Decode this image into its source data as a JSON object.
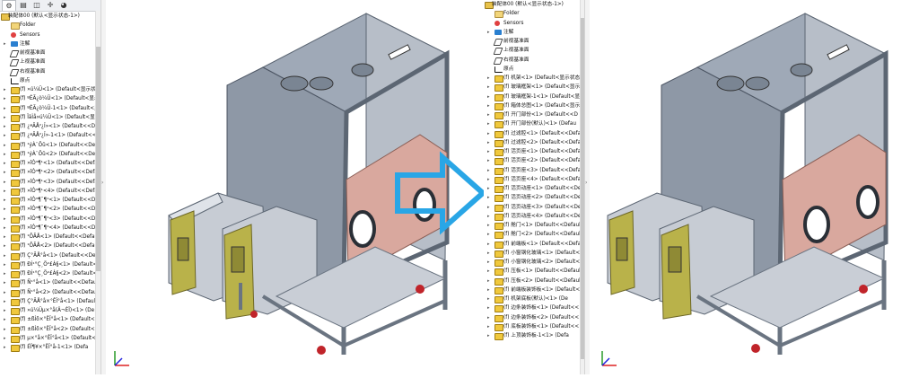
{
  "left_panel": {
    "tabs": [
      "feature-manager",
      "property-manager",
      "configuration-manager",
      "dimxpert-manager",
      "display-manager"
    ],
    "root": "装配体00 (默认<显示状态-1>)",
    "items": [
      {
        "label": "Folder",
        "icon": "folder-icon",
        "kind": "folder"
      },
      {
        "label": "Sensors",
        "icon": "sensor-icon",
        "kind": "sensor"
      },
      {
        "label": "注解",
        "icon": "annotation-icon",
        "kind": "anno",
        "arrow": true
      },
      {
        "label": "前视基准面",
        "icon": "plane-icon",
        "kind": "plane"
      },
      {
        "label": "上视基准面",
        "icon": "plane-icon",
        "kind": "plane"
      },
      {
        "label": "右视基准面",
        "icon": "plane-icon",
        "kind": "plane"
      },
      {
        "label": "原点",
        "icon": "origin-icon",
        "kind": "origin"
      },
      {
        "label": "(f) »ú¼Ü<1> (Default<显示状",
        "kind": "part"
      },
      {
        "label": "(f) ºÉÃ¿ò¼Ü<1> (Default<显示",
        "kind": "part"
      },
      {
        "label": "(f) ºÉÃ¿ò¼Ü-1<1> (Default<显示",
        "kind": "part"
      },
      {
        "label": "(f) ÏäÌå»ú¼Ü<1> (Default<显示",
        "kind": "part"
      },
      {
        "label": "(f) ¿ªÃÅ²¿Î»<1> (Default<<D",
        "kind": "part"
      },
      {
        "label": "(f) ¿ªÃÅ²¿Î»-1<1> (Default<<D",
        "kind": "part"
      },
      {
        "label": "(f) ¹ýÀ¨Õû<1> (Default<<Defau",
        "kind": "part"
      },
      {
        "label": "(f) ¹ýÀ¨Õû<2> (Default<<Defau",
        "kind": "part"
      },
      {
        "label": "(f) »îÒ³¶¹<1> (Default<<Defau",
        "kind": "part"
      },
      {
        "label": "(f) »îÒ³¶¹<2> (Default<<Defau",
        "kind": "part"
      },
      {
        "label": "(f) »îÒ³¶¹<3> (Default<<Defau",
        "kind": "part"
      },
      {
        "label": "(f) »îÒ³¶¹<4> (Default<<Defau",
        "kind": "part"
      },
      {
        "label": "(f) »îÒ³¶¯¶¹<1> (Default<<De",
        "kind": "part"
      },
      {
        "label": "(f) »îÒ³¶¯¶¹<2> (Default<<De",
        "kind": "part"
      },
      {
        "label": "(f) »îÒ³¶¯¶¹<3> (Default<<De",
        "kind": "part"
      },
      {
        "label": "(f) »îÒ³¶¯¶¹<4> (Default<<De",
        "kind": "part"
      },
      {
        "label": "(f) ¹ÔÃÅ<1> (Default<<Default",
        "kind": "part"
      },
      {
        "label": "(f) ¹ÔÃÅ<2> (Default<<Default",
        "kind": "part"
      },
      {
        "label": "(f) Ç°ÃÅ°å<1> (Default<<Defa",
        "kind": "part"
      },
      {
        "label": "(f) ÐÍ¹°Ç¸Ö²£Á§<1> (Default<",
        "kind": "part"
      },
      {
        "label": "(f) ÐÍ¹°Ç¸Ö²£Á§<2> (Default<",
        "kind": "part"
      },
      {
        "label": "(f) Ñ¹°å<1> (Default<<Default",
        "kind": "part"
      },
      {
        "label": "(f) Ñ¹°å<2> (Default<<Default",
        "kind": "part"
      },
      {
        "label": "(f) Ç°ÃÅ°å×°ÊÎ°å<1> (Default<",
        "kind": "part"
      },
      {
        "label": "(f) »ú¼Üµ×°å(Ä¬ÈÏ)<1> (De",
        "kind": "part"
      },
      {
        "label": "(f) ±ßÌõ×°ÊÎ°å<1> (Default<<",
        "kind": "part"
      },
      {
        "label": "(f) ±ßÌõ×°ÊÎ°å<2> (Default<<",
        "kind": "part"
      },
      {
        "label": "(f) µ×°å×°ÊÎ°å<1> (Default<<",
        "kind": "part"
      },
      {
        "label": "(f) ÉÏ¶¥×°ÊÎ°å-1<1> (Defa",
        "kind": "part"
      }
    ]
  },
  "right_panel": {
    "root": "装配体00 (默认<显示状态-1>)",
    "items": [
      {
        "label": "Folder",
        "icon": "folder-icon",
        "kind": "folder"
      },
      {
        "label": "Sensors",
        "icon": "sensor-icon",
        "kind": "sensor"
      },
      {
        "label": "注解",
        "icon": "annotation-icon",
        "kind": "anno",
        "arrow": true
      },
      {
        "label": "前视基准面",
        "icon": "plane-icon",
        "kind": "plane"
      },
      {
        "label": "上视基准面",
        "icon": "plane-icon",
        "kind": "plane"
      },
      {
        "label": "右视基准面",
        "icon": "plane-icon",
        "kind": "plane"
      },
      {
        "label": "原点",
        "icon": "origin-icon",
        "kind": "origin"
      },
      {
        "label": "(f) 机架<1> (Default<显示状态",
        "kind": "part"
      },
      {
        "label": "(f) 玻璃框架<1> (Default<显示",
        "kind": "part"
      },
      {
        "label": "(f) 玻璃框架-1<1> (Default<显",
        "kind": "part"
      },
      {
        "label": "(f) 箱体总图<1> (Default<显示",
        "kind": "part"
      },
      {
        "label": "(f) 开门部份<1> (Default<<D",
        "kind": "part"
      },
      {
        "label": "(f) 开门部份(默认)<1> (Defau",
        "kind": "part"
      },
      {
        "label": "(f) 过滤腔<1> (Default<<Defau",
        "kind": "part"
      },
      {
        "label": "(f) 过滤腔<2> (Default<<Defau",
        "kind": "part"
      },
      {
        "label": "(f) 活页座<1> (Default<<Defau",
        "kind": "part"
      },
      {
        "label": "(f) 活页座<2> (Default<<Defau",
        "kind": "part"
      },
      {
        "label": "(f) 活页座<3> (Default<<Defau",
        "kind": "part"
      },
      {
        "label": "(f) 活页座<4> (Default<<Defau",
        "kind": "part"
      },
      {
        "label": "(f) 活页动座<1> (Default<<De",
        "kind": "part"
      },
      {
        "label": "(f) 活页动座<2> (Default<<De",
        "kind": "part"
      },
      {
        "label": "(f) 活页动座<3> (Default<<De",
        "kind": "part"
      },
      {
        "label": "(f) 活页动座<4> (Default<<De",
        "kind": "part"
      },
      {
        "label": "(f) 舱门<1> (Default<<Default",
        "kind": "part"
      },
      {
        "label": "(f) 舱门<2> (Default<<Default",
        "kind": "part"
      },
      {
        "label": "(f) 前端板<1> (Default<<Defa",
        "kind": "part"
      },
      {
        "label": "(f) 小窗钢化玻璃<1> (Default<",
        "kind": "part"
      },
      {
        "label": "(f) 小窗钢化玻璃<2> (Default<",
        "kind": "part"
      },
      {
        "label": "(f) 压板<1> (Default<<Default",
        "kind": "part"
      },
      {
        "label": "(f) 压板<2> (Default<<Default",
        "kind": "part"
      },
      {
        "label": "(f) 前端板装饰板<1> (Default<",
        "kind": "part"
      },
      {
        "label": "(f) 机架底板(默认)<1> (De",
        "kind": "part"
      },
      {
        "label": "(f) 边条装饰板<1> (Default<<",
        "kind": "part"
      },
      {
        "label": "(f) 边条装饰板<2> (Default<<",
        "kind": "part"
      },
      {
        "label": "(f) 底板装饰板<1> (Default<<",
        "kind": "part"
      },
      {
        "label": "(f) 上顶装饰板-1<1> (Defa",
        "kind": "part"
      }
    ]
  },
  "viewport": {
    "background": "#ffffff",
    "frame_color": "#7c8897",
    "panel_color": "#a9b2bf",
    "floor_color": "#d9a89e",
    "door_color": "#b9b24a",
    "box_color": "#c7ccd4",
    "arrow_color": "#29a6e6",
    "wheel_color": "#c0242a"
  }
}
